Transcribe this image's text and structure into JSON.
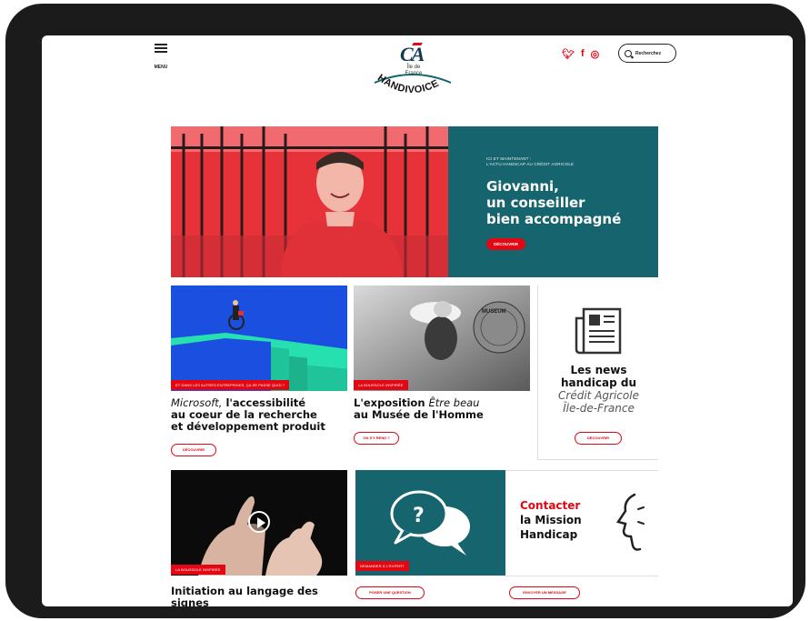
{
  "header": {
    "menu_label": "MENU",
    "logo_sub": "Île de France",
    "logo_word": "HANDIVOICE",
    "search_label": "Recherchez",
    "socials": [
      "twitter-icon",
      "facebook-icon",
      "instagram-icon"
    ]
  },
  "hero": {
    "kicker_line1": "ICI ET MAINTENANT :",
    "kicker_line2": "L'ACTU HANDICAP AU CRÉDIT AGRICOLE",
    "title_line1": "Giovanni,",
    "title_line2": "un conseiller",
    "title_line3": "bien accompagné",
    "button": "DÉCOUVRIR"
  },
  "cards": {
    "microsoft": {
      "tag": "ET DANS LES AUTRES ENTREPRISES, ÇA SE PASSE QUOI ?",
      "title_italic": "Microsoft,",
      "title_rest1": " l'accessibilité",
      "title_line2": "au coeur de la recherche",
      "title_line3": "et développement produit",
      "button": "DÉCOUVRIR"
    },
    "exposition": {
      "tag": "LA BOUSSOLE INSPIRÉE",
      "title_bold1": "L'exposition ",
      "title_italic": "Être beau",
      "title_line2": "au Musée de l'Homme",
      "button": "ON S'Y REND ?"
    },
    "news": {
      "title_line1": "Les news",
      "title_line2": "handicap du",
      "sub_line1": "Crédit Agricole",
      "sub_line2": "Île-de-France",
      "button": "DÉCOUVRIR"
    },
    "signes": {
      "tag": "LA BOUSSOLE INSPIRÉE",
      "title": "Initiation au langage des signes"
    },
    "question": {
      "tag": "DEMANDER À L'EXPERT",
      "button": "POSER UNE QUESTION"
    },
    "contact": {
      "line1": "Contacter",
      "line2": "la Mission",
      "line3": "Handicap",
      "button": "ENVOYER UN MESSAGE"
    }
  },
  "colors": {
    "brand_red": "#e30613",
    "teal": "#16646d",
    "navy": "#123a4f"
  }
}
